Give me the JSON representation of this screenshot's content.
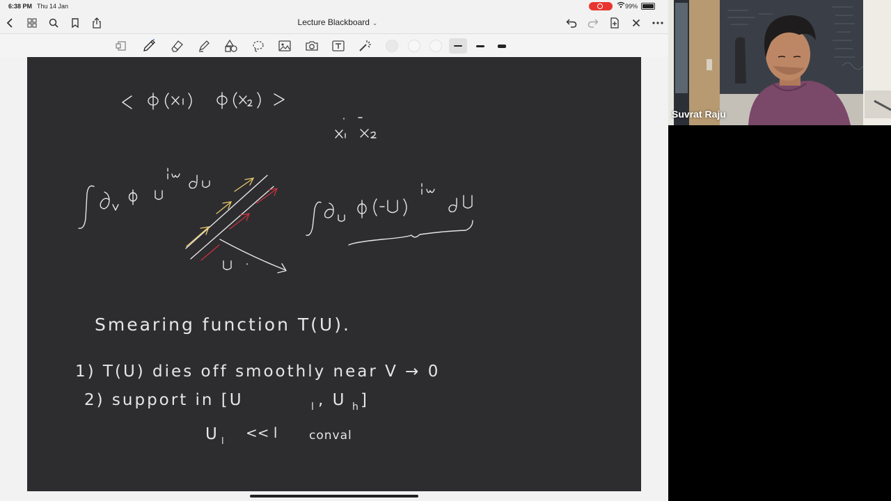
{
  "status_bar": {
    "time": "6:38 PM",
    "date": "Thu 14 Jan",
    "battery": "99%"
  },
  "nav_bar": {
    "title": "Lecture Blackboard",
    "left_icons": [
      "back-chevron-icon",
      "grid-icon",
      "search-icon",
      "bookmark-icon",
      "share-icon"
    ],
    "right_icons": [
      "undo-icon",
      "redo-icon",
      "add-page-icon",
      "close-icon",
      "more-icon"
    ]
  },
  "toolbar": {
    "tools": [
      "read-mode-icon",
      "pen-icon",
      "eraser-icon",
      "highlighter-icon",
      "shapes-icon",
      "lasso-icon",
      "image-icon",
      "camera-icon",
      "text-icon",
      "laser-pointer-icon"
    ],
    "active_tool": "pen-icon",
    "colors": [
      "#f7f7f7",
      "#f7f7f7",
      "#f7f7f7"
    ],
    "stroke_widths": [
      "thin",
      "medium",
      "thick"
    ],
    "selected_stroke": "thin"
  },
  "board": {
    "background": "#2d2d30",
    "ink_color": "#e6e6e6",
    "accent_yellow": "#e8c96a",
    "accent_red": "#c8323c"
  },
  "video": {
    "participant_name": "Suvrat Raju"
  }
}
